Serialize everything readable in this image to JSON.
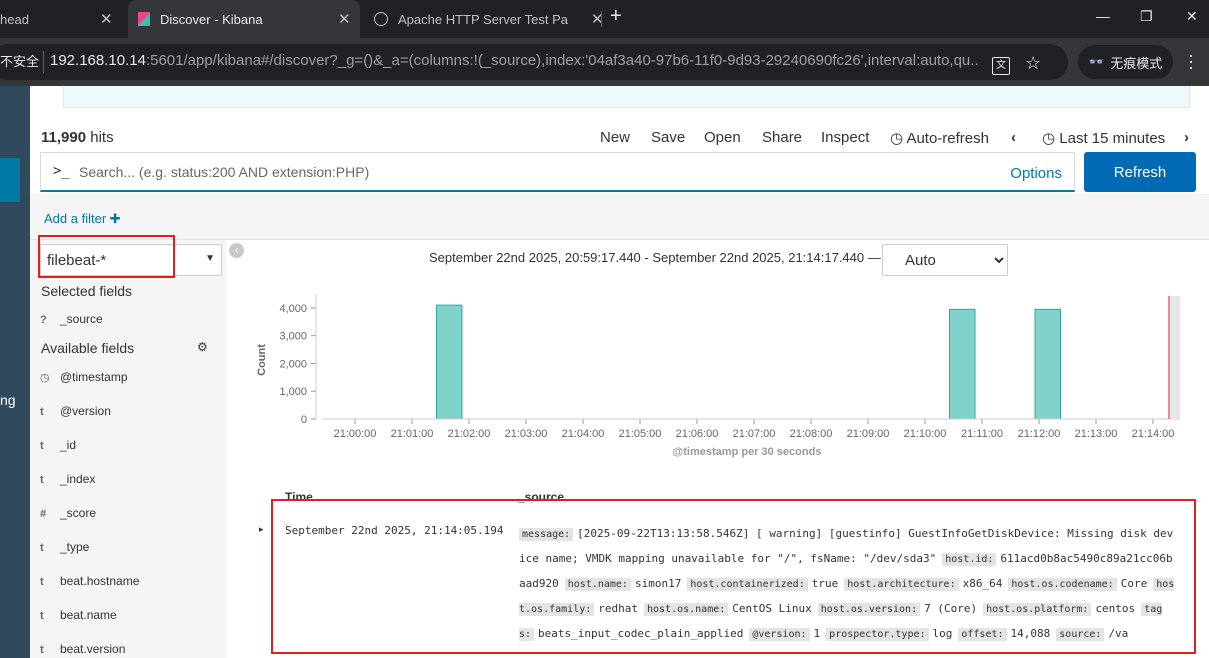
{
  "browser": {
    "tabs": [
      {
        "title": "head"
      },
      {
        "title": "Discover - Kibana"
      },
      {
        "title": "Apache HTTP Server Test Page"
      }
    ],
    "new_tab": "+",
    "security_label": "不安全",
    "url_host": "192.168.10.14",
    "url_rest": ":5601/app/kibana#/discover?_g=()&_a=(columns:!(_source),index:'04af3a40-97b6-11f0-9d93-29240690fc26',interval:auto,qu...",
    "incognito_label": "无痕模式",
    "min": "—",
    "max": "❐",
    "close": "✕"
  },
  "nav": {
    "partial_label": "ng"
  },
  "toolbar": {
    "hits_count": "11,990",
    "hits_label": "hits",
    "new": "New",
    "save": "Save",
    "open": "Open",
    "share": "Share",
    "inspect": "Inspect",
    "auto_refresh": "Auto-refresh",
    "time_picker": "Last 15 minutes"
  },
  "query": {
    "prompt": ">_",
    "placeholder": "Search... (e.g. status:200 AND extension:PHP)",
    "options": "Options",
    "refresh": "Refresh"
  },
  "filters": {
    "add_filter": "Add a filter"
  },
  "sidebar": {
    "index_pattern": "filebeat-*",
    "selected_heading": "Selected fields",
    "selected_fields": [
      {
        "type": "?",
        "name": "_source"
      }
    ],
    "available_heading": "Available fields",
    "available_fields": [
      {
        "type": "◷",
        "name": "@timestamp"
      },
      {
        "type": "t",
        "name": "@version"
      },
      {
        "type": "t",
        "name": "_id"
      },
      {
        "type": "t",
        "name": "_index"
      },
      {
        "type": "#",
        "name": "_score"
      },
      {
        "type": "t",
        "name": "_type"
      },
      {
        "type": "t",
        "name": "beat.hostname"
      },
      {
        "type": "t",
        "name": "beat.name"
      },
      {
        "type": "t",
        "name": "beat.version"
      }
    ]
  },
  "histogram": {
    "range_text": "September 22nd 2025, 20:59:17.440 - September 22nd 2025, 21:14:17.440 —",
    "interval": "Auto"
  },
  "chart_data": {
    "type": "bar",
    "xlabel": "@timestamp per 30 seconds",
    "ylabel": "Count",
    "ylim": [
      0,
      4500
    ],
    "yticks": [
      "0",
      "1,000",
      "2,000",
      "3,000",
      "4,000"
    ],
    "xticks": [
      "21:00:00",
      "21:01:00",
      "21:02:00",
      "21:03:00",
      "21:04:00",
      "21:05:00",
      "21:06:00",
      "21:07:00",
      "21:08:00",
      "21:09:00",
      "21:10:00",
      "21:11:00",
      "21:12:00",
      "21:13:00",
      "21:14:00"
    ],
    "bars": [
      {
        "start_minute": 1.5,
        "value": 4100
      },
      {
        "start_minute": 10.5,
        "value": 3950
      },
      {
        "start_minute": 12.0,
        "value": 3950
      }
    ],
    "bar_color": "#7fd3cb",
    "bar_stroke": "#2fa99d",
    "grid": false
  },
  "docs": {
    "col_time": "Time",
    "col_source": "_source",
    "expand": "▸",
    "rows": [
      {
        "time": "September 22nd 2025, 21:14:05.194",
        "fields": [
          {
            "k": "message:",
            "v": "[2025-09-22T13:13:58.546Z] [ warning] [guestinfo] GuestInfoGetDiskDevice: Missing disk device name; VMDK mapping unavailable for \"/\", fsName: \"/dev/sda3\""
          },
          {
            "k": "host.id:",
            "v": "611acd0b8ac5490c89a21cc06baad920"
          },
          {
            "k": "host.name:",
            "v": "simon17"
          },
          {
            "k": "host.containerized:",
            "v": "true"
          },
          {
            "k": "host.architecture:",
            "v": "x86_64"
          },
          {
            "k": "host.os.codename:",
            "v": "Core"
          },
          {
            "k": "host.os.family:",
            "v": "redhat"
          },
          {
            "k": "host.os.name:",
            "v": "CentOS Linux"
          },
          {
            "k": "host.os.version:",
            "v": "7 (Core)"
          },
          {
            "k": "host.os.platform:",
            "v": "centos"
          },
          {
            "k": "tags:",
            "v": "beats_input_codec_plain_applied"
          },
          {
            "k": "@version:",
            "v": "1"
          },
          {
            "k": "prospector.type:",
            "v": "log"
          },
          {
            "k": "offset:",
            "v": "14,088"
          },
          {
            "k": "source:",
            "v": "/va"
          }
        ]
      }
    ]
  },
  "colors": {
    "accent": "#0079a5",
    "button": "#006bb4",
    "nav": "#2f4a5c",
    "highlight": "#e02020"
  }
}
